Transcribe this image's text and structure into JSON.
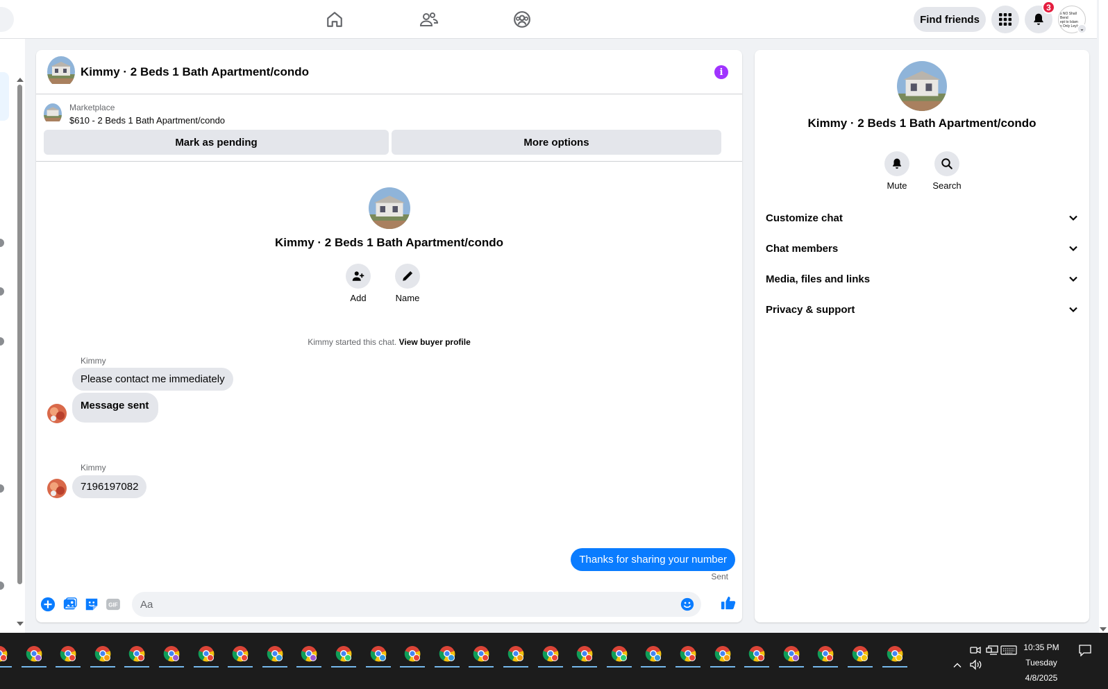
{
  "topbar": {
    "find_friends_label": "Find friends",
    "notifications_count": "3",
    "profile_thumbnail_lines": [
      "s NO Shall Bend",
      "ept to Islam",
      "s Only Leyla"
    ]
  },
  "chat": {
    "title": "Kimmy · 2 Beds 1 Bath Apartment/condo",
    "marketplace_label": "Marketplace",
    "listing_price_title": "$610 - 2 Beds 1 Bath Apartment/condo",
    "mark_pending_label": "Mark as pending",
    "more_options_label": "More options",
    "profile_name": "Kimmy · 2 Beds 1 Bath Apartment/condo",
    "add_label": "Add",
    "name_label": "Name",
    "started_text": "Kimmy started this chat.",
    "view_buyer_profile": "View buyer profile",
    "messages": [
      {
        "sender": "Kimmy",
        "text": "Please contact me immediately"
      },
      {
        "text": "Message sent"
      },
      {
        "sender": "Kimmy",
        "text": "7196197082"
      }
    ],
    "outgoing": {
      "text": "Thanks for sharing your number",
      "status": "Sent"
    },
    "composer_placeholder": "Aa"
  },
  "details": {
    "name": "Kimmy · 2 Beds 1 Bath Apartment/condo",
    "mute_label": "Mute",
    "search_label": "Search",
    "sections": [
      "Customize chat",
      "Chat members",
      "Media, files and links",
      "Privacy & support"
    ]
  },
  "taskbar": {
    "time": "10:35 PM",
    "day": "Tuesday",
    "date": "4/8/2025"
  },
  "colors": {
    "accent_blue": "#0a7cff",
    "info_purple": "#a033ff",
    "badge_red": "#e41e3f"
  }
}
